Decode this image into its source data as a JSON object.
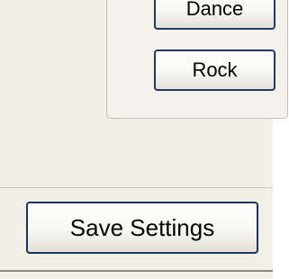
{
  "genre_group": {
    "buttons": [
      {
        "label": "Dance"
      },
      {
        "label": "Rock"
      }
    ]
  },
  "footer": {
    "save_label": "Save Settings"
  },
  "colors": {
    "panel_background": "#f1efe6",
    "button_border": "#1c3a6a",
    "group_border": "#c4c1b3"
  }
}
